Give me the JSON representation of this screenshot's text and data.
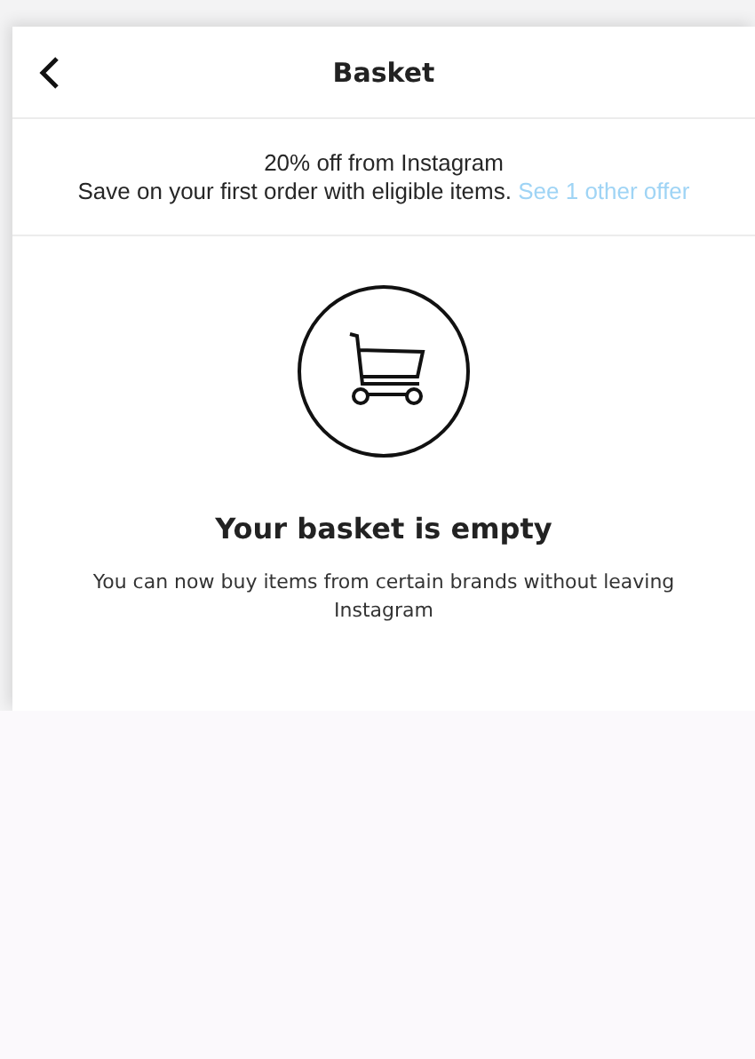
{
  "header": {
    "title": "Basket"
  },
  "offer": {
    "title": "20% off from Instagram",
    "text": "Save on your first order with eligible items.",
    "link": "See 1 other offer"
  },
  "empty_state": {
    "heading": "Your basket is empty",
    "description": "You can now buy items from certain brands without leaving Instagram"
  }
}
